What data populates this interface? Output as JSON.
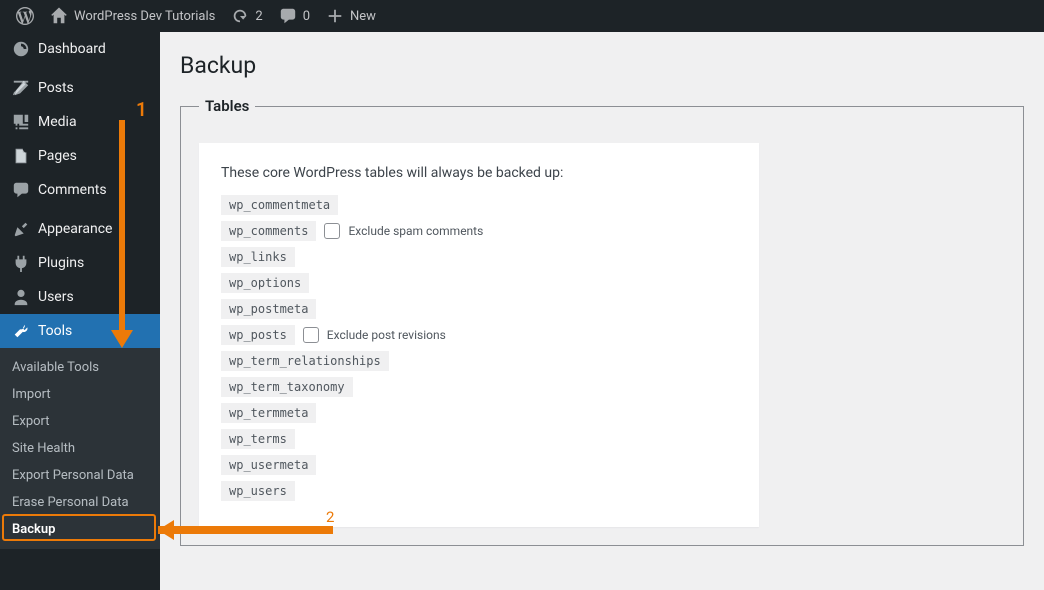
{
  "adminbar": {
    "site_title": "WordPress Dev Tutorials",
    "updates_count": "2",
    "comments_count": "0",
    "new_label": "New"
  },
  "sidebar": {
    "items": [
      {
        "label": "Dashboard",
        "icon": "dashboard"
      },
      {
        "label": "Posts",
        "icon": "posts"
      },
      {
        "label": "Media",
        "icon": "media"
      },
      {
        "label": "Pages",
        "icon": "pages"
      },
      {
        "label": "Comments",
        "icon": "comments"
      },
      {
        "label": "Appearance",
        "icon": "appearance"
      },
      {
        "label": "Plugins",
        "icon": "plugins"
      },
      {
        "label": "Users",
        "icon": "users"
      },
      {
        "label": "Tools",
        "icon": "tools"
      }
    ],
    "submenu": [
      "Available Tools",
      "Import",
      "Export",
      "Site Health",
      "Export Personal Data",
      "Erase Personal Data",
      "Backup"
    ]
  },
  "page": {
    "title": "Backup",
    "panel_legend": "Tables",
    "description": "These core WordPress tables will always be backed up:",
    "tables": [
      {
        "name": "wp_commentmeta"
      },
      {
        "name": "wp_comments",
        "checkbox_label": "Exclude spam comments"
      },
      {
        "name": "wp_links"
      },
      {
        "name": "wp_options"
      },
      {
        "name": "wp_postmeta"
      },
      {
        "name": "wp_posts",
        "checkbox_label": "Exclude post revisions"
      },
      {
        "name": "wp_term_relationships"
      },
      {
        "name": "wp_term_taxonomy"
      },
      {
        "name": "wp_termmeta"
      },
      {
        "name": "wp_terms"
      },
      {
        "name": "wp_usermeta"
      },
      {
        "name": "wp_users"
      }
    ]
  },
  "annotations": {
    "one": "1",
    "two": "2"
  }
}
